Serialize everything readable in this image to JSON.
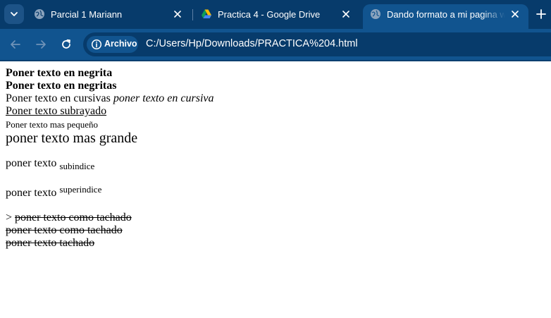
{
  "browser": {
    "tabs": [
      {
        "title": "Parcial 1 Mariann",
        "favicon": "globe-icon",
        "active": false
      },
      {
        "title": "Practica 4 - Google Drive",
        "favicon": "google-drive-icon",
        "active": false
      },
      {
        "title": "Dando formato a mi pagina web",
        "favicon": "globe-icon",
        "active": true
      }
    ],
    "security_chip": "Archivo",
    "url": "C:/Users/Hp/Downloads/PRACTICA%204.html",
    "colors": {
      "tabstrip": "#073b6b",
      "toolbar": "#11548f",
      "active_tab": "#11548f",
      "omnibox": "#073b6b"
    }
  },
  "page": {
    "bold1": "Poner texto en negrita",
    "bold2": "Poner texto en negritas",
    "italic_prefix": "Poner texto en cursivas",
    "italic_text": "poner texto en cursiva",
    "underline": "Poner texto subrayado",
    "small": "Poner texto mas pequeño",
    "big": "poner texto mas grande",
    "sub_prefix": "poner texto",
    "sub_text": "subindice",
    "sup_prefix": "poner texto",
    "sup_text": "superindice",
    "strike_prefix": ">",
    "strike1": "poner texto como tachado",
    "strike2": "poner texto como tachado",
    "strike3": "poner texto tachado"
  }
}
